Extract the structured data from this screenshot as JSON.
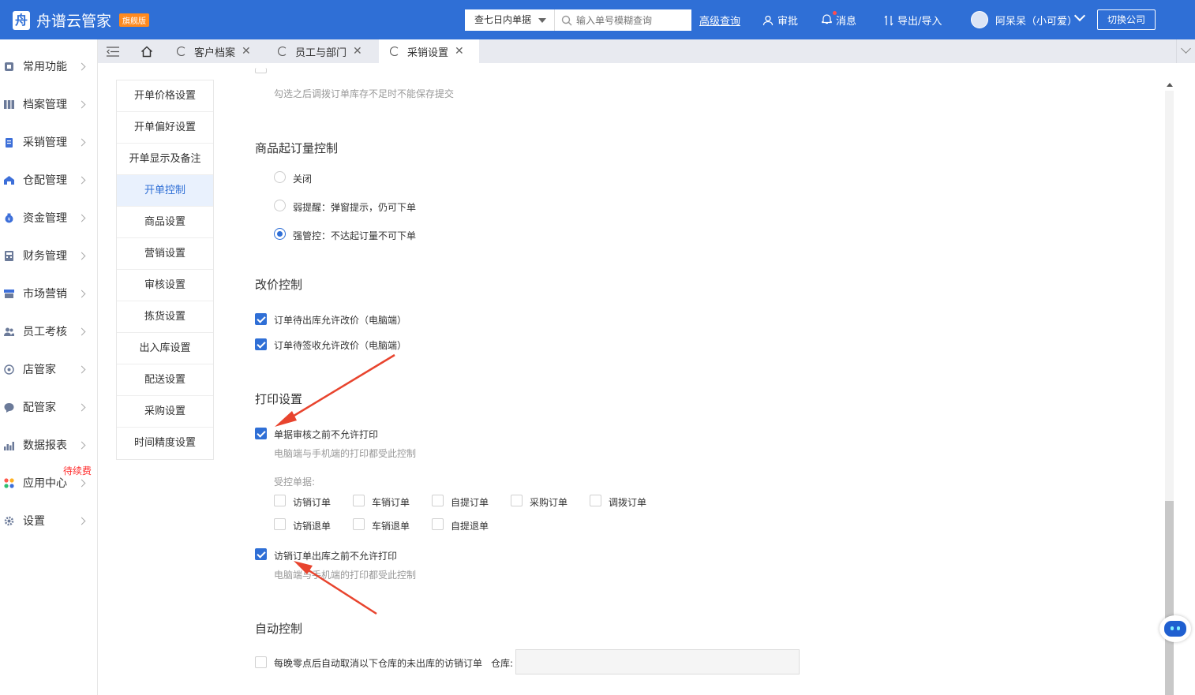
{
  "header": {
    "app_name": "舟谱云管家",
    "edition_badge": "旗舰版",
    "date_range": "查七日内单据",
    "search_placeholder": "输入单号模糊查询",
    "advanced_search": "高级查询",
    "approval": "审批",
    "messages": "消息",
    "export_import": "导出/导入",
    "user_name": "阿呆呆（小可爱）",
    "switch_company": "切换公司",
    "brand_color": "#2f6fd6"
  },
  "sidebar": {
    "items": [
      {
        "label": "常用功能",
        "icon": "common-icon"
      },
      {
        "label": "档案管理",
        "icon": "grid-icon"
      },
      {
        "label": "采销管理",
        "icon": "clipboard-icon"
      },
      {
        "label": "仓配管理",
        "icon": "warehouse-icon"
      },
      {
        "label": "资金管理",
        "icon": "money-bag-icon"
      },
      {
        "label": "财务管理",
        "icon": "calculator-icon"
      },
      {
        "label": "市场营销",
        "icon": "store-icon"
      },
      {
        "label": "员工考核",
        "icon": "people-icon"
      },
      {
        "label": "店管家",
        "icon": "shop-icon"
      },
      {
        "label": "配管家",
        "icon": "chat-icon"
      },
      {
        "label": "数据报表",
        "icon": "chart-icon"
      },
      {
        "label": "应用中心",
        "icon": "apps-icon",
        "badge": "待续费"
      },
      {
        "label": "设置",
        "icon": "gear-icon"
      }
    ]
  },
  "tabs": [
    {
      "label": "客户档案"
    },
    {
      "label": "员工与部门"
    },
    {
      "label": "采销设置"
    }
  ],
  "settings_nav": {
    "items": [
      "开单价格设置",
      "开单偏好设置",
      "开单显示及备注",
      "开单控制",
      "商品设置",
      "营销设置",
      "审核设置",
      "拣货设置",
      "出入库设置",
      "配送设置",
      "采购设置",
      "时间精度设置"
    ],
    "active_index": 3
  },
  "form": {
    "top_hint": "勾选之后调拨订单库存不足时不能保存提交",
    "min_order": {
      "title": "商品起订量控制",
      "options": [
        "关闭",
        "弱提醒：弹窗提示，仍可下单",
        "强管控：不达起订量不可下单"
      ],
      "selected_index": 2
    },
    "price_control": {
      "title": "改价控制",
      "options": [
        {
          "label": "订单待出库允许改价（电脑端）",
          "checked": true
        },
        {
          "label": "订单待签收允许改价（电脑端）",
          "checked": true
        }
      ]
    },
    "print": {
      "title": "打印设置",
      "no_print_before_audit": "单据审核之前不允许打印",
      "no_print_before_audit_checked": true,
      "hint1": "电脑端与手机端的打印都受此控制",
      "controlled_label": "受控单据:",
      "controlled_docs_row1": [
        "访销订单",
        "车销订单",
        "自提订单",
        "采购订单",
        "调拨订单"
      ],
      "controlled_docs_row2": [
        "访销退单",
        "车销退单",
        "自提退单"
      ],
      "no_print_before_outbound": "访销订单出库之前不允许打印",
      "no_print_before_outbound_checked": true,
      "hint2": "电脑端与手机端的打印都受此控制"
    },
    "auto": {
      "title": "自动控制",
      "cancel_label": "每晚零点后自动取消以下仓库的未出库的访销订单",
      "warehouse_label": "仓库:"
    }
  },
  "annotation_color": "#e8442e"
}
